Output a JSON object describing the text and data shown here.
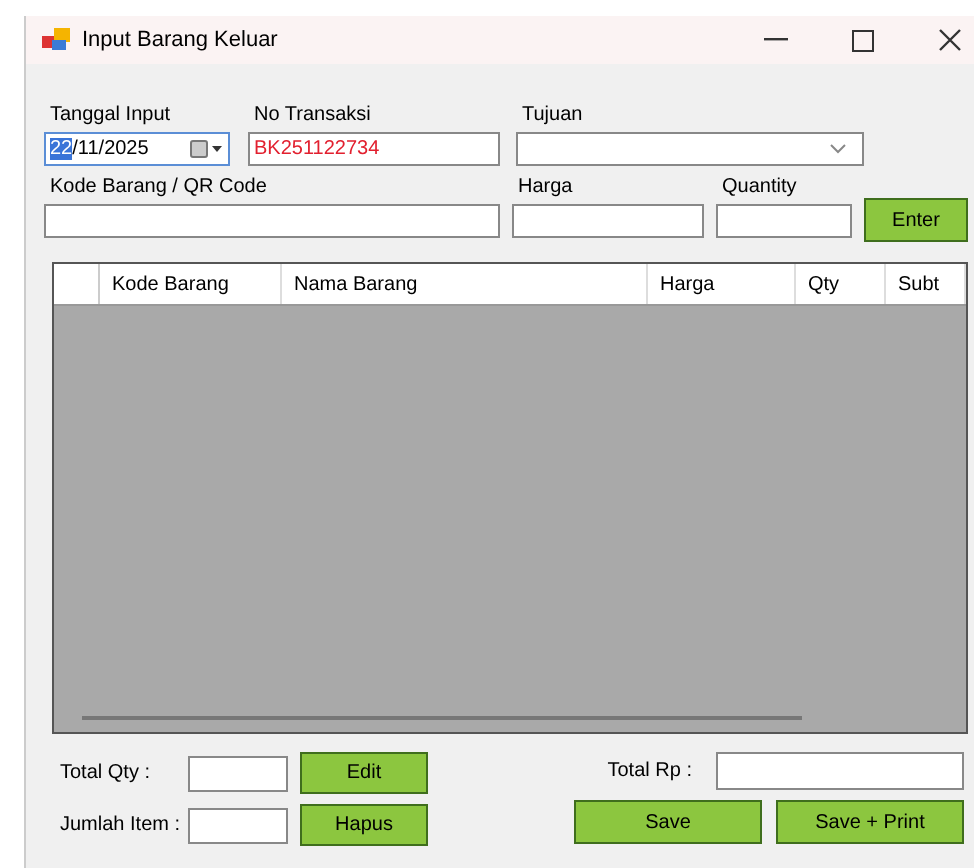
{
  "window": {
    "title": "Input Barang Keluar"
  },
  "form": {
    "tanggal_label": "Tanggal Input",
    "tanggal_parts": [
      {
        "text": "22",
        "selected": true
      },
      {
        "text": "/11/2025",
        "selected": false
      }
    ],
    "transaksi_label": "No Transaksi",
    "transaksi_value": "BK251122734",
    "tujuan_label": "Tujuan",
    "kode_label": "Kode Barang / QR Code",
    "harga_label": "Harga",
    "quantity_label": "Quantity",
    "enter_button": "Enter"
  },
  "table": {
    "columns": [
      "Kode Barang",
      "Nama Barang",
      "Harga",
      "Qty",
      "Subt"
    ]
  },
  "footer": {
    "total_qty_label": "Total Qty :",
    "jumlah_item_label": "Jumlah Item :",
    "edit_button": "Edit",
    "hapus_button": "Hapus",
    "total_rp_label": "Total Rp :",
    "save_button": "Save",
    "save_print_button": "Save + Print"
  }
}
